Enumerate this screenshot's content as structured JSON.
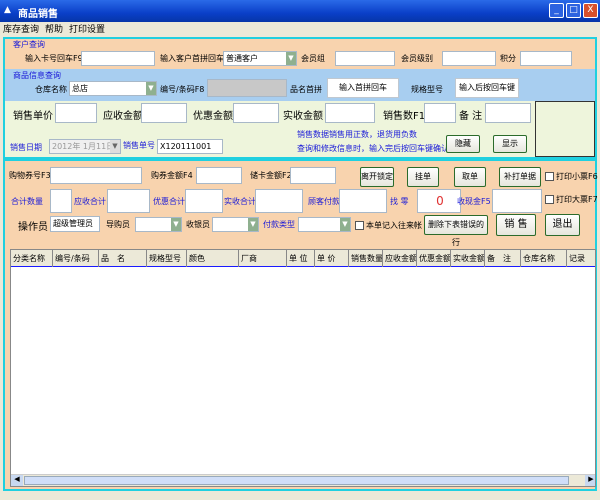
{
  "window": {
    "title": "商品销售",
    "min": "_",
    "max": "□",
    "close": "X"
  },
  "menu": [
    "库存查询",
    "帮助",
    "打印设置"
  ],
  "customer": {
    "section": "客户查询",
    "card_label": "输入卡号回车F9",
    "pinyin_label": "输入客户首拼回车",
    "customer_type": "普通客户",
    "group_label": "会员组",
    "level_label": "会员级别",
    "points_label": "积分"
  },
  "product": {
    "section": "商品信息查询",
    "warehouse_label": "仓库名称",
    "warehouse": "总店",
    "code_label": "编号/条码F8",
    "name_label": "品名首拼",
    "name_btn": "输入首拼回车",
    "spec_label": "规格型号",
    "spec_btn": "输入后按回车键"
  },
  "sale": {
    "price": "销售单价",
    "receivable": "应收金额",
    "discount": "优惠金额",
    "actual": "实收金额",
    "qty": "销售数F11",
    "remark": "备 注",
    "hint1": "销售数据销售用正数，退货用负数",
    "hint2": "查询和修改信息时，输入完后按回车键确认",
    "hide": "隐藏",
    "show": "显示",
    "date_label": "销售日期",
    "date": "2012年 1月11日",
    "order_label": "销售单号",
    "order_no": "X120111001"
  },
  "pay": {
    "voucher_no": "购物券号F3",
    "voucher_amt": "购券金额F4",
    "card_amt": "储卡金额F2",
    "leave_lock": "离开锁定",
    "hold": "挂单",
    "take": "取单",
    "reprint": "补打单据",
    "print_small": "打印小票F6",
    "total_qty": "合计数量",
    "total_recv": "应收合计",
    "total_disc": "优惠合计",
    "total_actual": "实收合计",
    "cust_pay": "顾客付款",
    "change_label": "找 零",
    "change": "0",
    "coupon": "收现金F5",
    "print_big": "打印大票F7",
    "operator_label": "操作员",
    "operator": "超级管理员",
    "guide": "导购员",
    "cashier": "收银员",
    "pay_type": "付款类型",
    "credit": "本单记入往来帐",
    "delete_row": "删除下表错误的行",
    "sell": "销 售",
    "exit": "退出"
  },
  "grid": {
    "columns": [
      "分类名称",
      "编号/条码",
      "品　名",
      "规格型号",
      "颜色",
      "厂商",
      "单 位",
      "单 价",
      "销售数量",
      "应收金额",
      "优惠金额",
      "实收金额",
      "备　注",
      "仓库名称",
      "记录"
    ]
  }
}
